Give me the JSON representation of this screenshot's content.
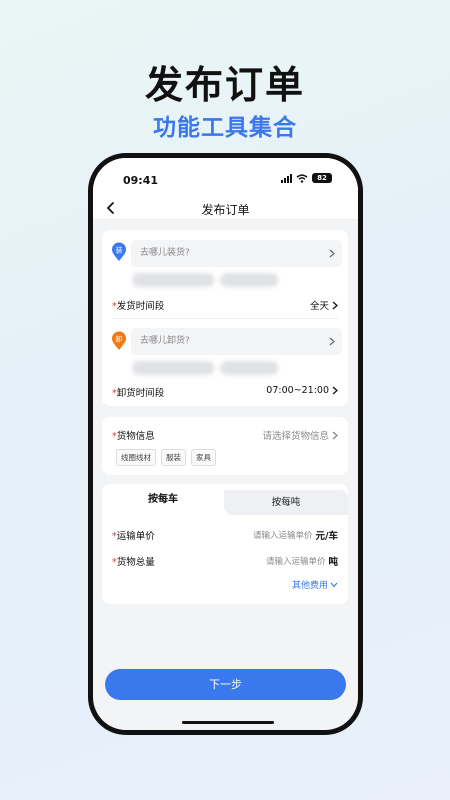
{
  "promo": {
    "title": "发布订单",
    "subtitle": "功能工具集合"
  },
  "status_bar": {
    "time": "09:41",
    "battery": "82"
  },
  "nav": {
    "title": "发布订单"
  },
  "loading": {
    "badge": "装",
    "placeholder": "去哪儿装货?",
    "time_label": "发货时间段",
    "time_value": "全天"
  },
  "unloading": {
    "badge": "卸",
    "placeholder": "去哪儿卸货?",
    "time_label": "卸货时间段",
    "time_value": "07:00~21:00"
  },
  "cargo": {
    "label": "货物信息",
    "placeholder": "请选择货物信息",
    "tags": [
      "线圈线材",
      "服装",
      "家具"
    ]
  },
  "pricing": {
    "tabs": [
      "按每车",
      "按每吨"
    ],
    "unit_price_label": "运输单价",
    "unit_price_placeholder": "请输入运输单价",
    "unit_price_unit": "元/车",
    "total_label": "货物总量",
    "total_placeholder": "请输入运输单价",
    "total_unit": "吨",
    "other_fees": "其他费用"
  },
  "required_mark": "*",
  "next_button": "下一步",
  "colors": {
    "accent": "#3a78ee",
    "loading_pin": "#3a78ee",
    "unloading_pin": "#f07a1a",
    "required": "#e53935"
  }
}
